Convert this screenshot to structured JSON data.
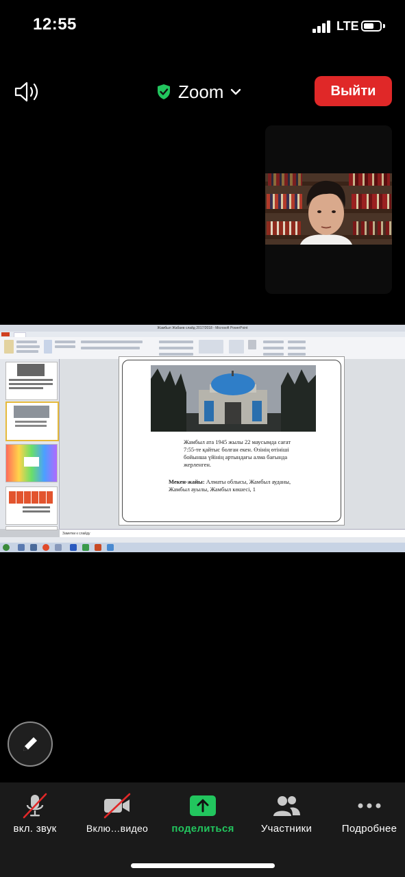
{
  "status_bar": {
    "time": "12:55",
    "network": "LTE"
  },
  "header": {
    "app_name": "Zoom",
    "leave_label": "Выйти"
  },
  "shared_screen": {
    "window_title": "Жамбыл Жабаев слайд 2017/2018 - Microsoft PowerPoint",
    "notes_placeholder": "Заметки к слайду",
    "slide": {
      "paragraph1": "Жамбыл ата 1945 жылы 22 маусымда сағат 7:55-те қайтыс болған екен. Өзінің өтініші бойынша үйінің артындағы алма бағында жерленген.",
      "address_label": "Мекен-жайы:",
      "address_value": " Алматы облысы, Жамбыл ауданы, Жамбыл ауылы, Жамбыл көшесі, 1"
    }
  },
  "toolbar": {
    "audio_label": "вкл. звук",
    "video_label": "Вклю…видео",
    "share_label": "поделиться",
    "participants_label": "Участники",
    "more_label": "Подробнее"
  },
  "colors": {
    "leave": "#e02828",
    "share_green": "#22c55e",
    "mute_red": "#e02828"
  }
}
